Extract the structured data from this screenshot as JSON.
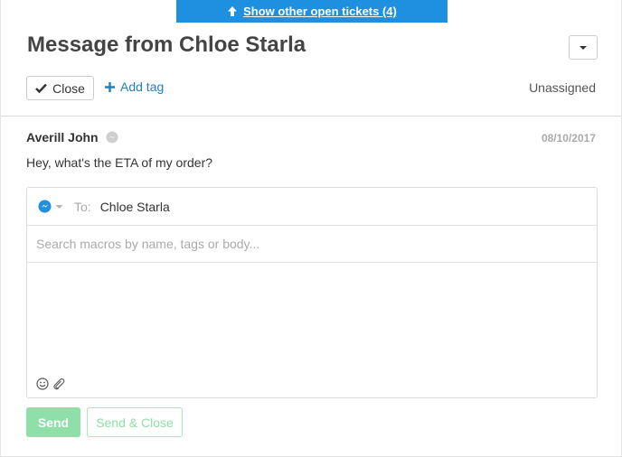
{
  "banner": {
    "label": "Show other open tickets (4)",
    "color": "#1f8fe0"
  },
  "ticket": {
    "title": "Message from Chloe Starla",
    "close_label": "Close",
    "add_tag_label": "Add tag",
    "assignee": "Unassigned"
  },
  "message": {
    "sender": "Averill John",
    "date": "08/10/2017",
    "body": "Hey, what's the ETA of my order?"
  },
  "composer": {
    "channel_icon": "messenger-icon",
    "to_label": "To:",
    "to_value": "Chloe Starla",
    "macro_placeholder": "Search macros by name, tags or body...",
    "body_value": ""
  },
  "actions": {
    "send_label": "Send",
    "send_close_label": "Send & Close",
    "send_color": "#8fe0a8"
  },
  "colors": {
    "accent": "#1f7fbf",
    "link": "#1f7fbf"
  }
}
